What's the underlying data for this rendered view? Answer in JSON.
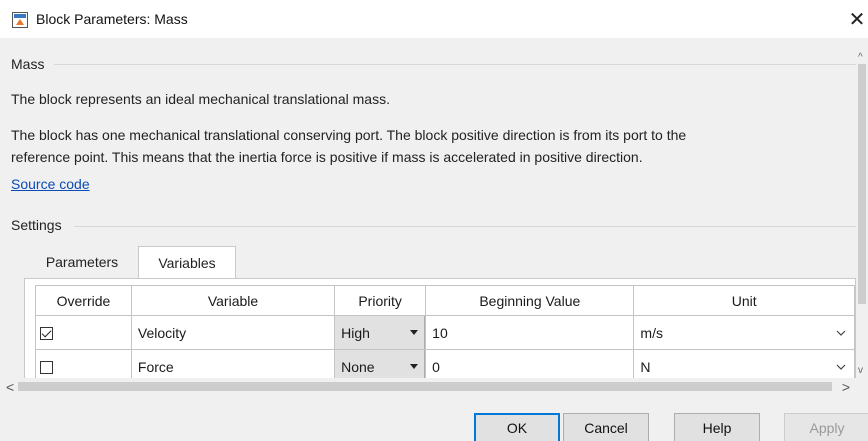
{
  "window": {
    "title": "Block Parameters: Mass",
    "close_glyph": "✕"
  },
  "mass_section": {
    "title": "Mass",
    "description_1": "The block represents an ideal mechanical translational mass.",
    "description_2_line1": "The block has one mechanical translational conserving port. The block positive direction is from its port to the",
    "description_2_line2": "reference point. This means that the inertia force is positive if mass is accelerated in positive direction.",
    "source_link": "Source code"
  },
  "settings_section": {
    "title": "Settings",
    "tabs": [
      {
        "label": "Parameters",
        "active": false
      },
      {
        "label": "Variables",
        "active": true
      }
    ]
  },
  "variables_table": {
    "headers": {
      "override": "Override",
      "variable": "Variable",
      "priority": "Priority",
      "beginning_value": "Beginning Value",
      "unit": "Unit"
    },
    "rows": [
      {
        "override": true,
        "variable": "Velocity",
        "priority": "High",
        "beginning_value": "10",
        "unit": "m/s"
      },
      {
        "override": false,
        "variable": "Force",
        "priority": "None",
        "beginning_value": "0",
        "unit": "N"
      }
    ]
  },
  "scrollbars": {
    "left_arrow": "<",
    "right_arrow": ">",
    "up_arrow": "^",
    "down_arrow": "v"
  },
  "buttons": {
    "ok": "OK",
    "cancel": "Cancel",
    "help": "Help",
    "apply": "Apply"
  },
  "colors": {
    "link": "#0b4bb5",
    "ok_border": "#0078d7"
  }
}
